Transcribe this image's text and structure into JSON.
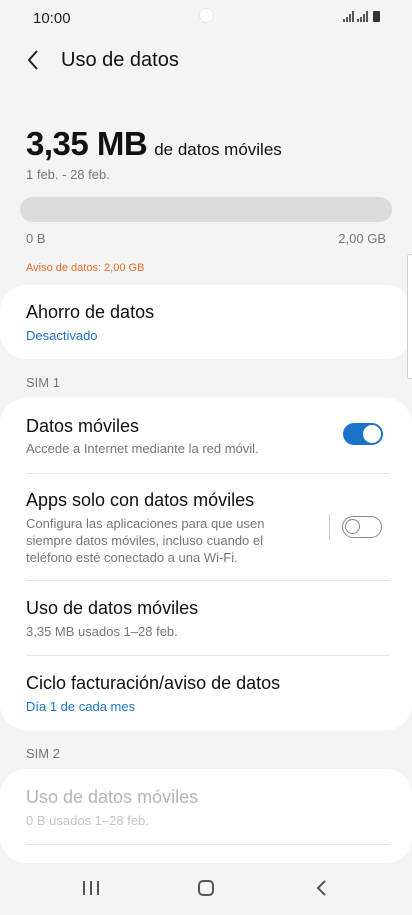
{
  "status_bar": {
    "time": "10:00"
  },
  "header": {
    "title": "Uso de datos"
  },
  "usage": {
    "value": "3,35 MB",
    "unit_text": "de datos móviles",
    "period": "1 feb. - 28 feb.",
    "bar_min_label": "0 B",
    "bar_max_label": "2,00 GB",
    "bar_fill_fraction": 0.0,
    "warning": "Aviso de datos: 2,00 GB"
  },
  "data_saver": {
    "title": "Ahorro de datos",
    "status": "Desactivado"
  },
  "sim1": {
    "label": "SIM 1",
    "mobile_data": {
      "title": "Datos móviles",
      "subtitle": "Accede a Internet mediante la red móvil.",
      "enabled": true
    },
    "mobile_only_apps": {
      "title": "Apps solo con datos móviles",
      "subtitle_lines": [
        "Configura las aplicaciones para que usen",
        "siempre datos móviles, incluso cuando el",
        "teléfono esté conectado a una Wi-Fi."
      ],
      "enabled": false
    },
    "mobile_usage": {
      "title": "Uso de datos móviles",
      "subtitle": "3,35 MB usados 1–28 feb."
    },
    "billing": {
      "title": "Ciclo facturación/aviso de datos",
      "subtitle": "Día 1 de cada mes"
    }
  },
  "sim2": {
    "label": "SIM 2",
    "mobile_usage": {
      "title": "Uso de datos móviles",
      "subtitle": "0 B usados 1–28 feb."
    }
  },
  "colors": {
    "accent": "#1a73c9",
    "warning": "#e86b2c",
    "background": "#f4f4f4"
  },
  "icons": [
    "back-arrow-icon",
    "wifi-signal-icon",
    "signal-icon",
    "battery-icon",
    "recent-apps-icon",
    "home-icon",
    "nav-back-icon"
  ]
}
